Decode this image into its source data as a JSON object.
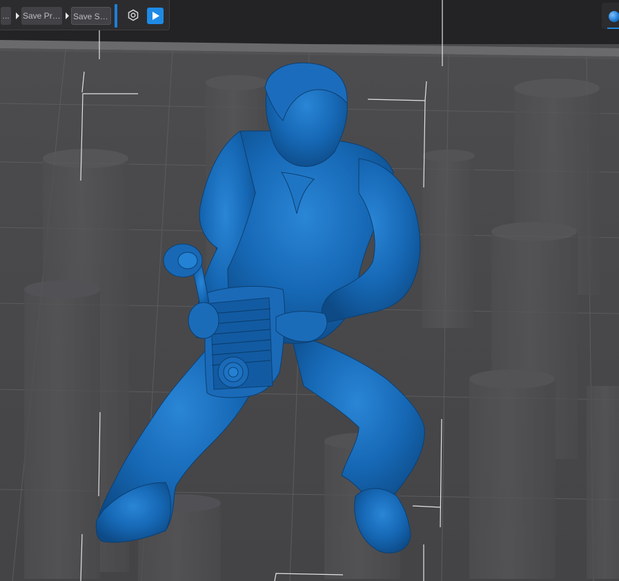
{
  "toolbar": {
    "step_1_label": "...",
    "step_2_label": "Save Pro...",
    "step_3_label": "Save Slice",
    "settings_icon": "hexagon-gear-icon",
    "play_icon": "play-icon"
  },
  "view_control": {
    "icon": "sphere-icon"
  },
  "colors": {
    "accent": "#1f8ae6",
    "model": "#1565b0",
    "plate": "#4a4a4c",
    "toolbar": "#2c2c2e"
  }
}
